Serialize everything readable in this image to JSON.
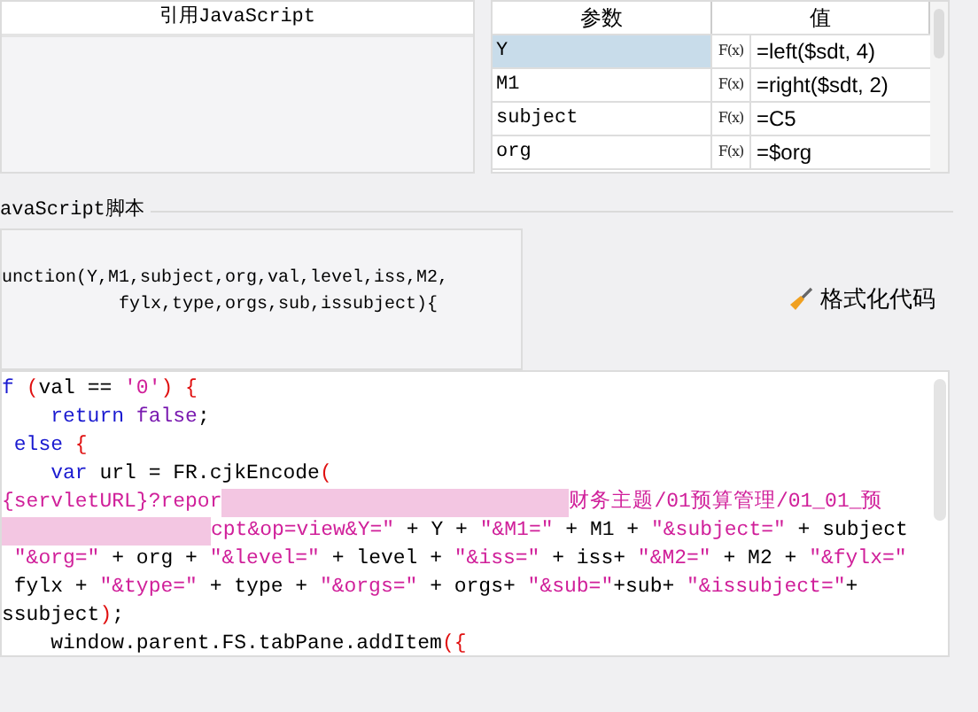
{
  "reference_panel": {
    "title": "引用JavaScript"
  },
  "param_table": {
    "columns": [
      "参数",
      "值"
    ],
    "rows": [
      {
        "name": "Y",
        "formula_label": "F(x)",
        "value": "=left($sdt, 4)",
        "selected": true
      },
      {
        "name": "M1",
        "formula_label": "F(x)",
        "value": "=right($sdt, 2)",
        "selected": false
      },
      {
        "name": "subject",
        "formula_label": "F(x)",
        "value": "=C5",
        "selected": false
      },
      {
        "name": "org",
        "formula_label": "F(x)",
        "value": "=$org",
        "selected": false
      }
    ]
  },
  "script_section": {
    "title": "avaScript脚本"
  },
  "function_header": [
    "unction(Y,M1,subject,org,val,level,iss,M2,",
    "           fylx,type,orgs,sub,issubject){"
  ],
  "format_button": {
    "label": "格式化代码"
  },
  "code_lines": [
    [
      {
        "kind": "keyword",
        "text": "f "
      },
      {
        "kind": "bracket",
        "text": "("
      },
      {
        "kind": "plain",
        "text": "val == "
      },
      {
        "kind": "string",
        "text": "'0'"
      },
      {
        "kind": "bracket",
        "text": ") {"
      }
    ],
    [
      {
        "kind": "keyword",
        "text": "    return "
      },
      {
        "kind": "literal",
        "text": "false"
      },
      {
        "kind": "plain",
        "text": ";"
      }
    ],
    [
      {
        "kind": "keyword",
        "text": " else "
      },
      {
        "kind": "bracket",
        "text": "{"
      }
    ],
    [
      {
        "kind": "keyword",
        "text": "    var"
      },
      {
        "kind": "plain",
        "text": " url = FR.cjkEncode"
      },
      {
        "kind": "bracket",
        "text": "("
      }
    ],
    [
      {
        "kind": "string",
        "text": "{servletURL}?repor"
      },
      {
        "kind": "redacted"
      },
      {
        "kind": "string",
        "text": "财务主题/01预算管理/01_01_预"
      }
    ],
    [
      {
        "kind": "redacted"
      },
      {
        "kind": "string",
        "text": "cpt&op=view&Y=\""
      },
      {
        "kind": "plain",
        "text": " + Y + "
      },
      {
        "kind": "string",
        "text": "\"&M1=\""
      },
      {
        "kind": "plain",
        "text": " + M1 + "
      },
      {
        "kind": "string",
        "text": "\"&subject=\""
      },
      {
        "kind": "plain",
        "text": " + subject"
      }
    ],
    [
      {
        "kind": "string",
        "text": " \"&org=\""
      },
      {
        "kind": "plain",
        "text": " + org + "
      },
      {
        "kind": "string",
        "text": "\"&level=\""
      },
      {
        "kind": "plain",
        "text": " + level + "
      },
      {
        "kind": "string",
        "text": "\"&iss=\""
      },
      {
        "kind": "plain",
        "text": " + iss+ "
      },
      {
        "kind": "string",
        "text": "\"&M2=\""
      },
      {
        "kind": "plain",
        "text": " + M2 + "
      },
      {
        "kind": "string",
        "text": "\"&fylx=\""
      }
    ],
    [
      {
        "kind": "plain",
        "text": " fylx + "
      },
      {
        "kind": "string",
        "text": "\"&type=\""
      },
      {
        "kind": "plain",
        "text": " + type + "
      },
      {
        "kind": "string",
        "text": "\"&orgs=\""
      },
      {
        "kind": "plain",
        "text": " + orgs+ "
      },
      {
        "kind": "string",
        "text": "\"&sub=\""
      },
      {
        "kind": "plain",
        "text": "+sub+ "
      },
      {
        "kind": "string",
        "text": "\"&issubject=\""
      },
      {
        "kind": "plain",
        "text": "+"
      }
    ],
    [
      {
        "kind": "plain",
        "text": "ssubject"
      },
      {
        "kind": "bracket",
        "text": ")"
      },
      {
        "kind": "plain",
        "text": ";"
      }
    ],
    [
      {
        "kind": "plain",
        "text": "    window.parent.FS.tabPane.addItem"
      },
      {
        "kind": "bracket",
        "text": "({"
      }
    ]
  ]
}
